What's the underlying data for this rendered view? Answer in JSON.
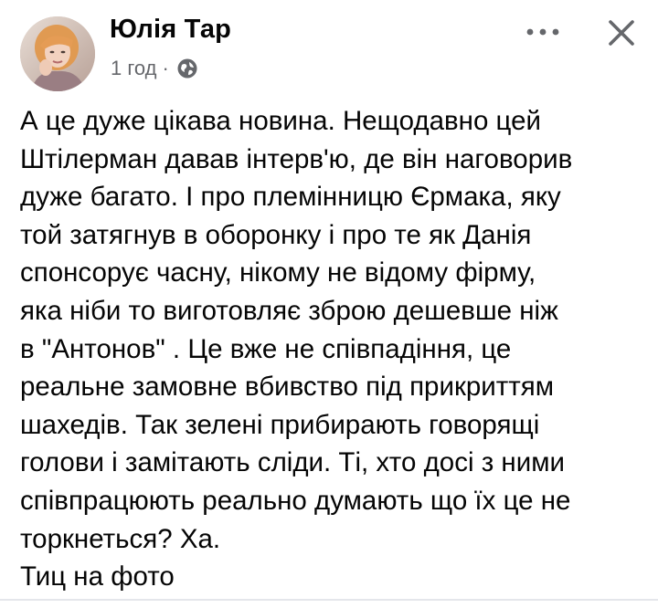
{
  "post": {
    "author": "Юлія Тар",
    "time": "1 год",
    "separator": "·",
    "audience_icon": "globe-icon",
    "more_icon": "more-horizontal-icon",
    "close_icon": "close-icon",
    "lines": [
      "А це дуже цікава новина. Нещодавно цей",
      "Штілерман давав інтерв'ю, де він наговорив",
      "дуже багато. І про племінницю Єрмака, яку",
      "той затягнув в оборонку і про те як Данія",
      "спонсорує часну, нікому не відому фірму,",
      "яка ніби то виготовляє зброю дешевше ніж",
      "в \"Антонов\" . Це вже не співпадіння, це",
      "реальне замовне вбивство під прикриттям",
      "шахедів. Так зелені прибирають говорящі",
      "голови і замітають сліди. Ті, хто досі з ними",
      "співпрацюють реально думають що їх це не",
      "торкнеться? Ха.",
      "Тиц на фото"
    ]
  },
  "colors": {
    "text_primary": "#050505",
    "text_secondary": "#65676b",
    "background": "#ffffff"
  }
}
